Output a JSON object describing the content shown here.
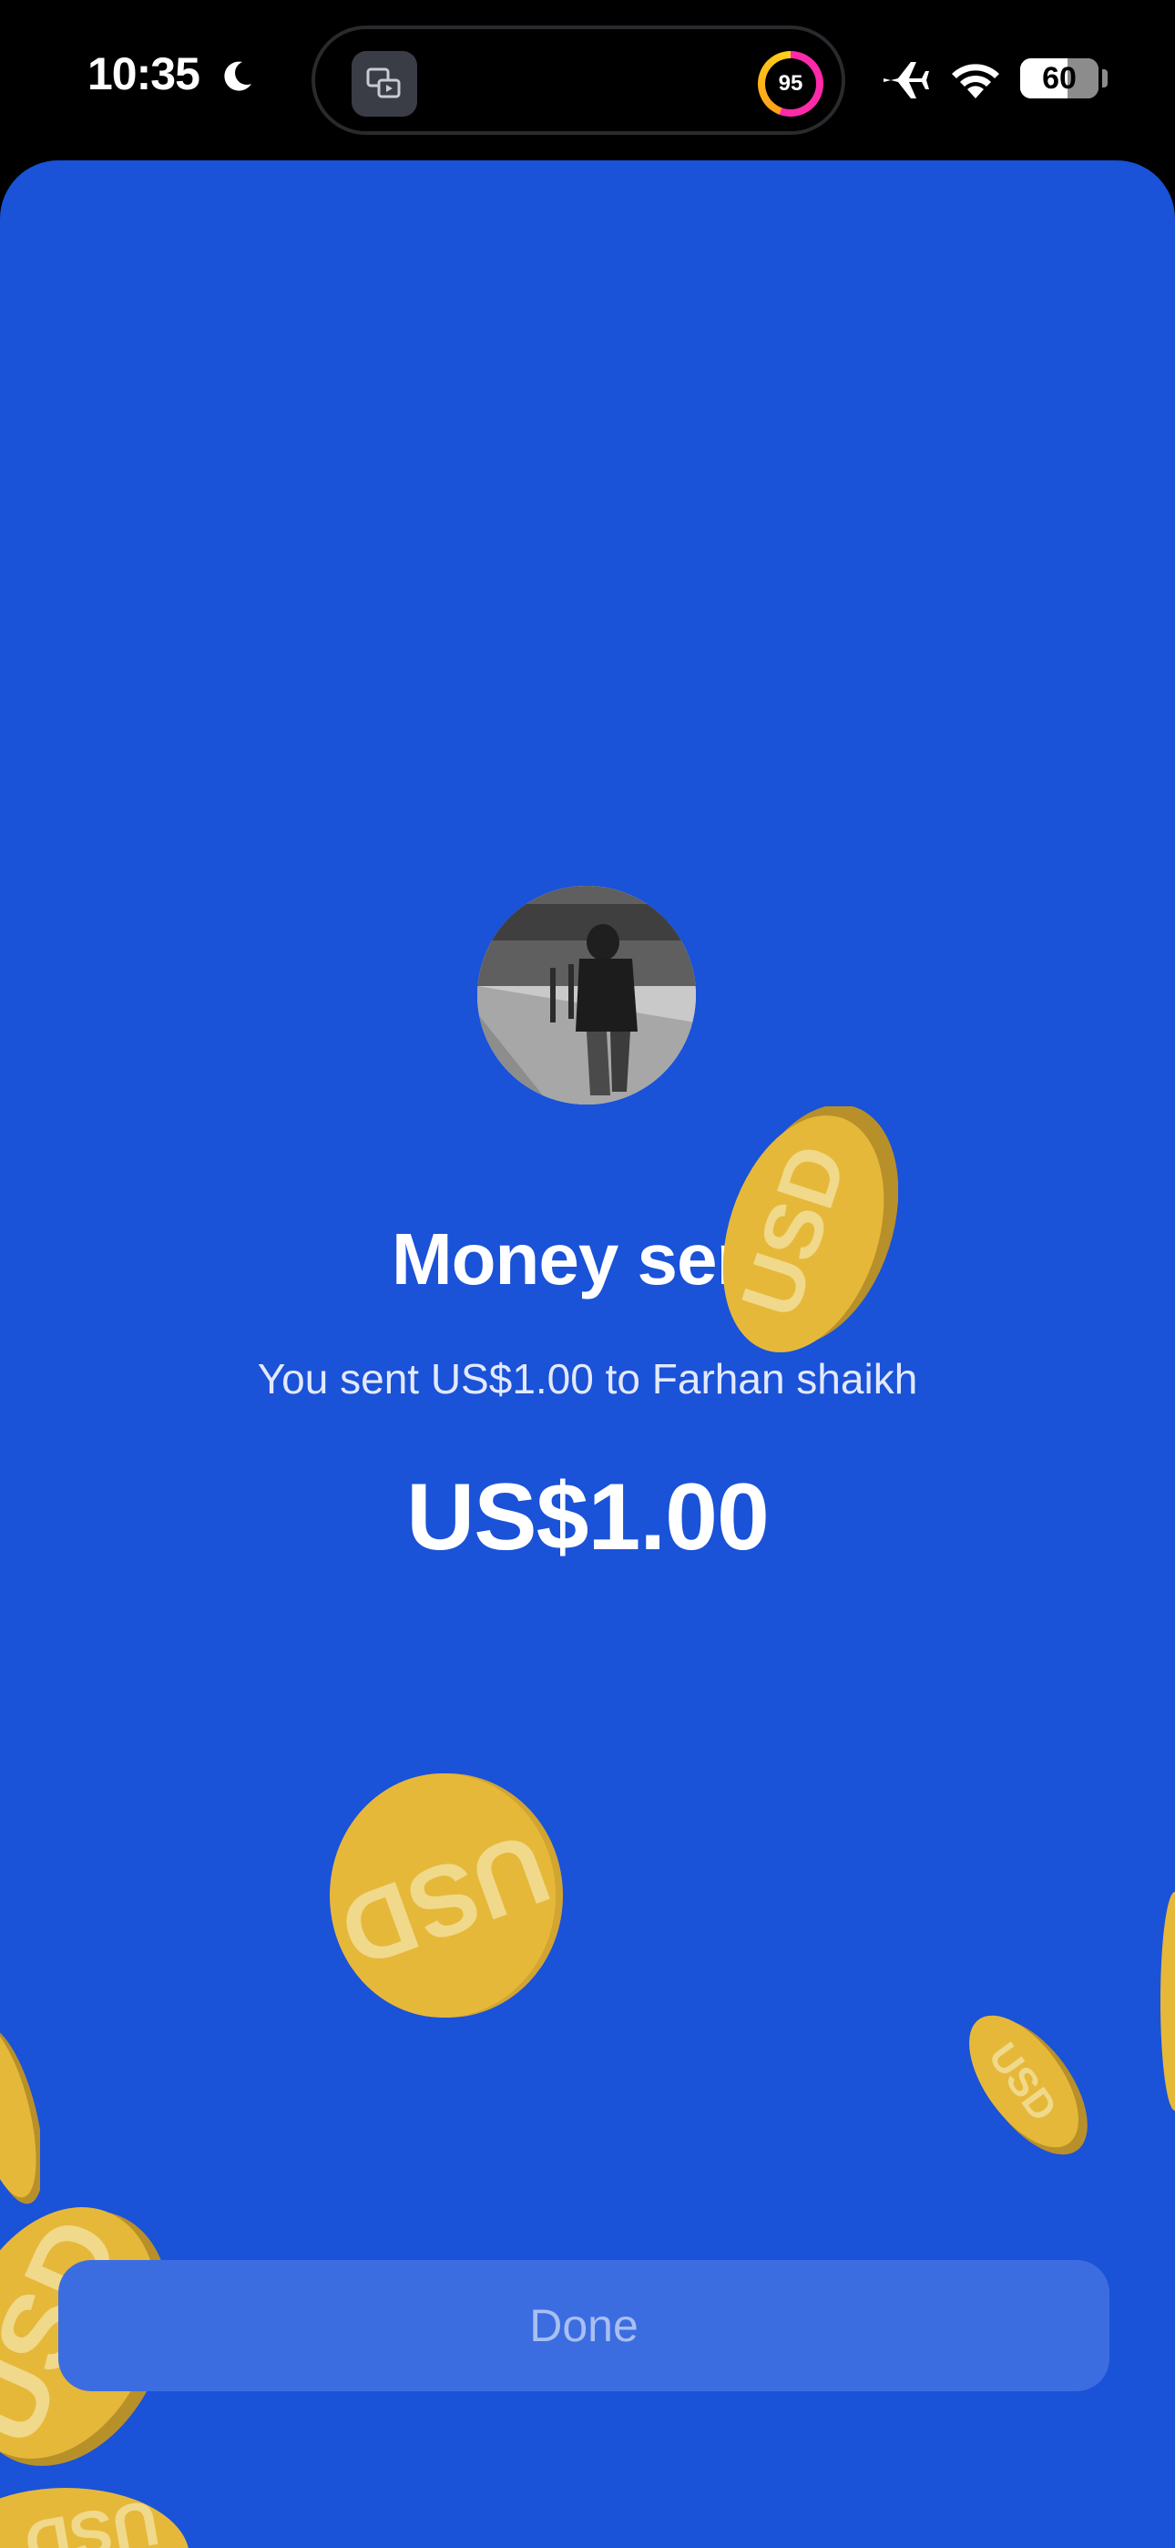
{
  "status_bar": {
    "time": "10:35",
    "ring_value": "95",
    "battery_level": "60"
  },
  "confirmation": {
    "title": "Money sent",
    "subtitle": "You sent US$1.00 to Farhan shaikh",
    "amount": "US$1.00",
    "done_label": "Done"
  },
  "colors": {
    "background": "#1a52d8",
    "coin": "#e6b83a",
    "button": "#3c6de0"
  },
  "icons": {
    "coin_glyph": "USD"
  }
}
